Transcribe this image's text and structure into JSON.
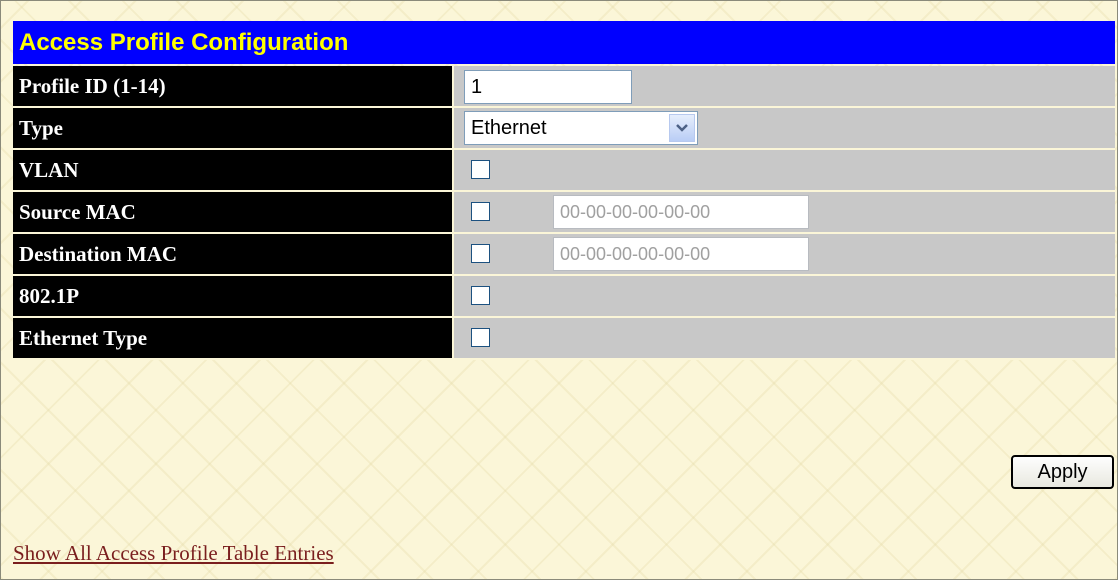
{
  "page": {
    "title": "Access Profile Configuration",
    "colors": {
      "title_bg": "#0000ff",
      "title_text": "#ffff00",
      "label_bg": "#000000",
      "value_bg": "#c8c8c8"
    }
  },
  "rows": {
    "profile_id": {
      "label": "Profile ID (1-14)",
      "value": "1"
    },
    "type": {
      "label": "Type",
      "selected": "Ethernet",
      "icon": "chevron-down-icon"
    },
    "vlan": {
      "label": "VLAN",
      "checked": false
    },
    "source_mac": {
      "label": "Source MAC",
      "checked": false,
      "mac_placeholder": "00-00-00-00-00-00"
    },
    "destination_mac": {
      "label": "Destination MAC",
      "checked": false,
      "mac_placeholder": "00-00-00-00-00-00"
    },
    "p8021": {
      "label": "802.1P",
      "checked": false
    },
    "ethernet_type": {
      "label": "Ethernet Type",
      "checked": false
    }
  },
  "actions": {
    "apply_label": "Apply",
    "show_all_link": "Show All Access Profile Table Entries"
  }
}
